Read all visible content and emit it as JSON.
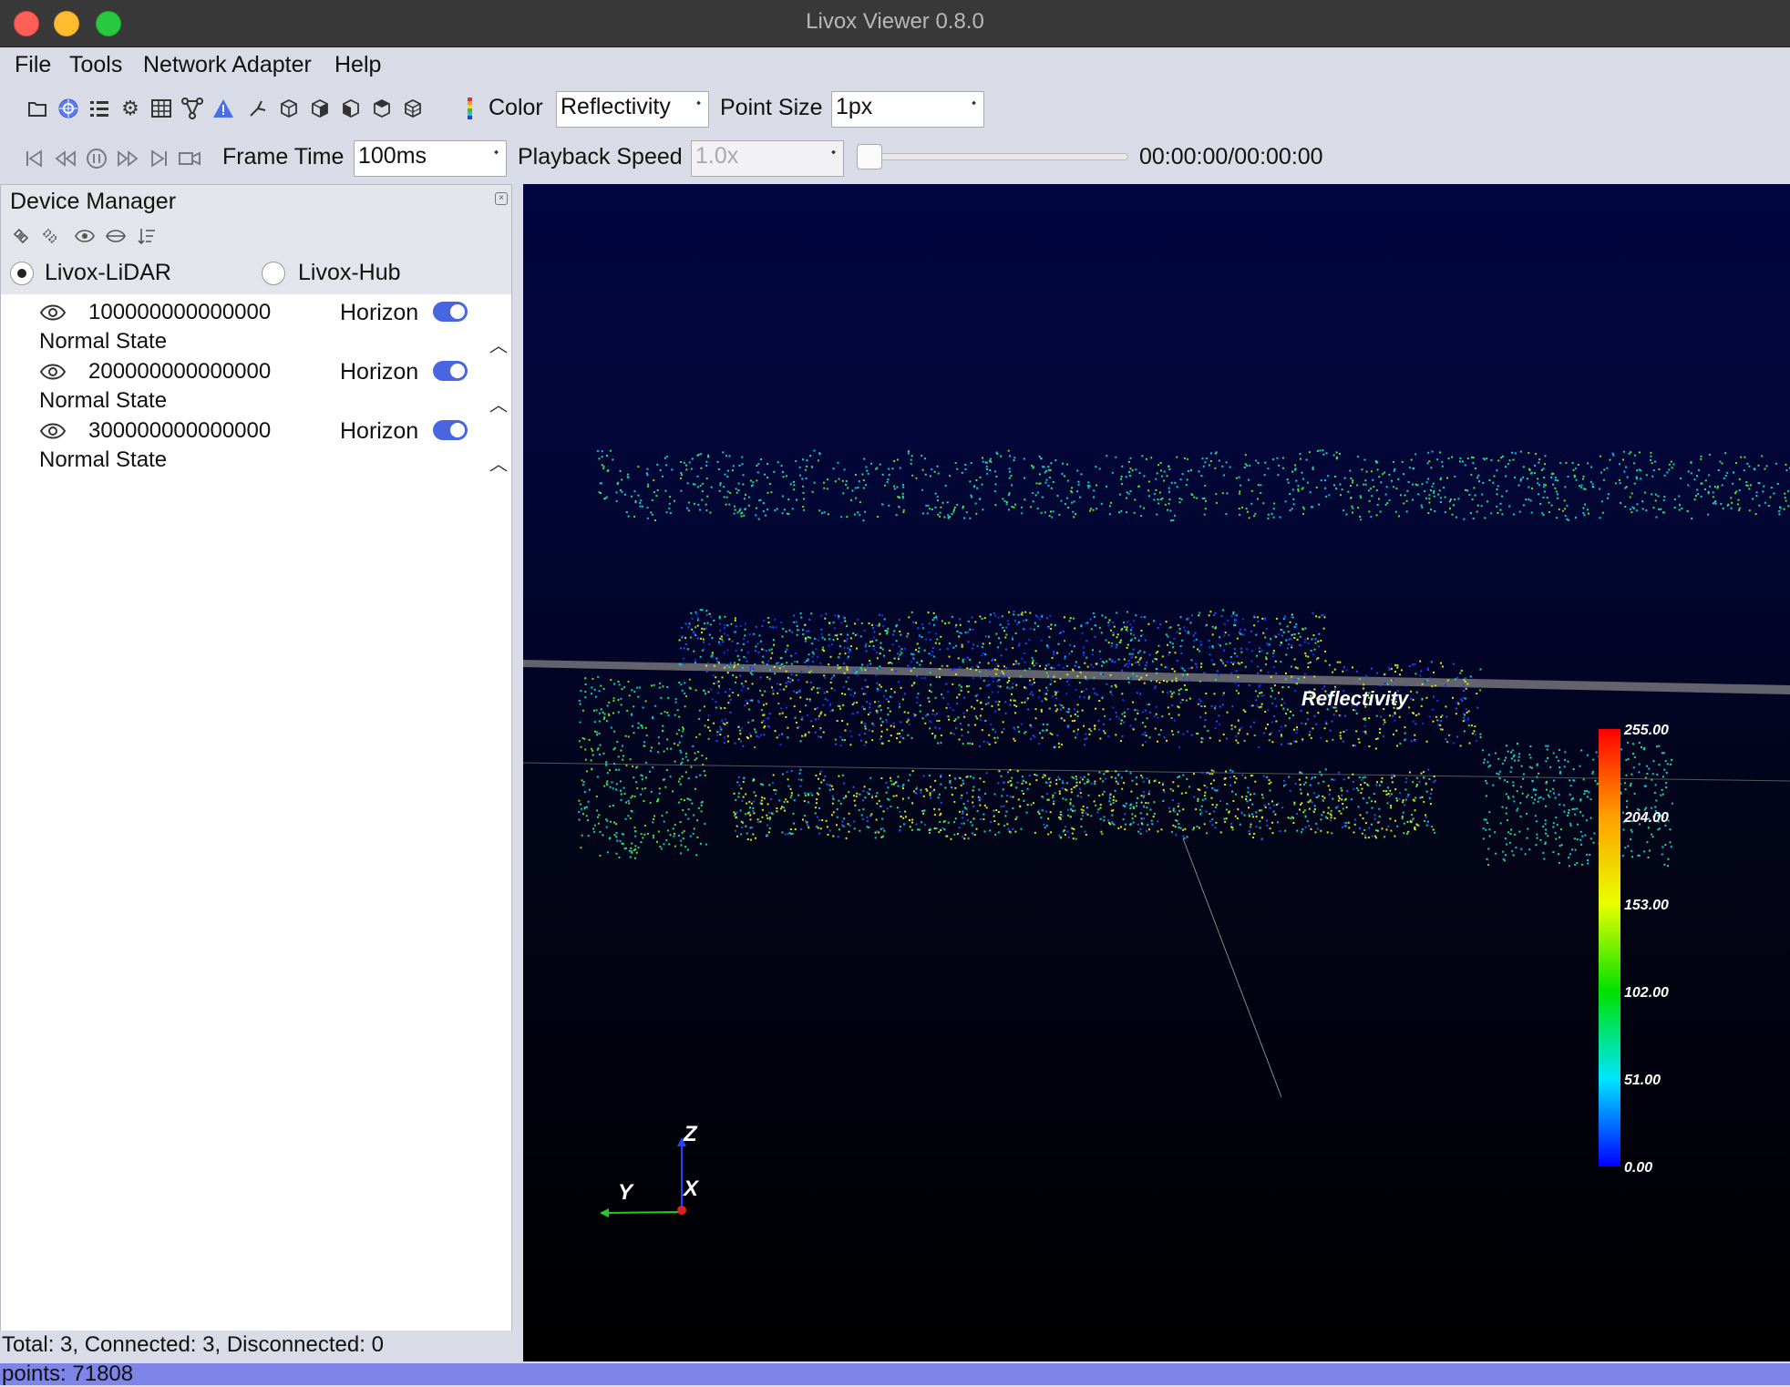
{
  "window": {
    "title": "Livox Viewer 0.8.0"
  },
  "menu": [
    "File",
    "Tools",
    "Network Adapter",
    "Help"
  ],
  "toolbar": {
    "icons": [
      "folder-icon",
      "lidar-icon",
      "list-icon",
      "gear-icon",
      "table-icon",
      "network-icon",
      "warning-icon",
      "tool-icon",
      "cube-front-icon",
      "cube-side-icon",
      "cube-top-icon",
      "cube-iso-icon",
      "cube-back-icon"
    ],
    "color_label": "Color",
    "color_value": "Reflectivity",
    "point_size_label": "Point Size",
    "point_size_value": "1px"
  },
  "playback": {
    "frame_time_label": "Frame Time",
    "frame_time_value": "100ms",
    "speed_label": "Playback Speed",
    "speed_value": "1.0x",
    "time": "00:00:00/00:00:00",
    "progress": 0
  },
  "device_manager": {
    "title": "Device Manager",
    "radio_lidar": "Livox-LiDAR",
    "radio_hub": "Livox-Hub",
    "selected": "Livox-LiDAR",
    "devices": [
      {
        "sn": "100000000000000",
        "type": "Horizon",
        "state": "Normal State",
        "enabled": true
      },
      {
        "sn": "200000000000000",
        "type": "Horizon",
        "state": "Normal State",
        "enabled": true
      },
      {
        "sn": "300000000000000",
        "type": "Horizon",
        "state": "Normal State",
        "enabled": true
      }
    ],
    "summary": "Total: 3, Connected: 3, Disconnected: 0"
  },
  "status": {
    "points": "points: 71808"
  },
  "viewport": {
    "legend_title": "Reflectivity",
    "legend_ticks": [
      "255.00",
      "204.00",
      "153.00",
      "102.00",
      "51.00",
      "0.00"
    ],
    "axes": {
      "z": "Z",
      "y": "Y",
      "x": "X"
    }
  }
}
